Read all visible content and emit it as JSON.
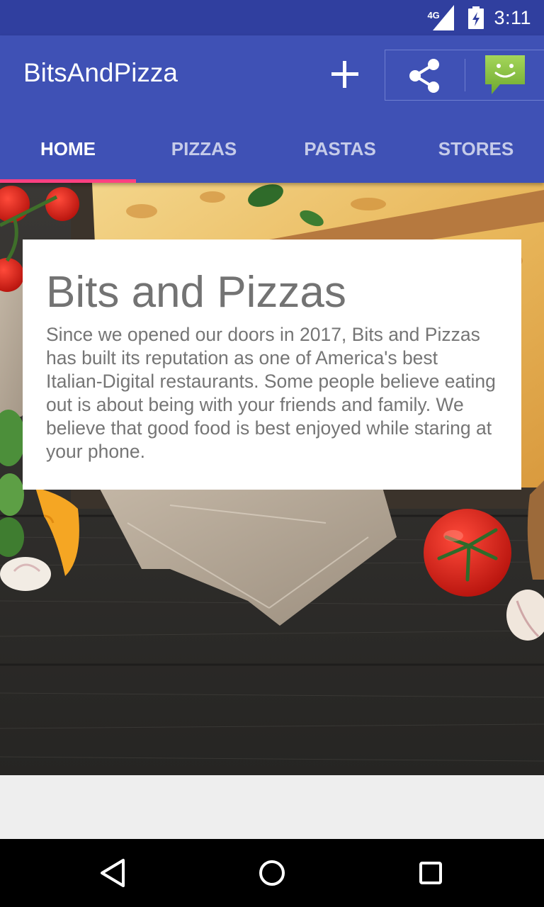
{
  "status_bar": {
    "network": "4G",
    "time": "3:11"
  },
  "app_bar": {
    "title": "BitsAndPizza",
    "actions": [
      "add-icon",
      "share-icon",
      "message-icon"
    ]
  },
  "tabs": [
    {
      "label": "HOME",
      "active": true
    },
    {
      "label": "PIZZAS",
      "active": false
    },
    {
      "label": "PASTAS",
      "active": false
    },
    {
      "label": "STORES",
      "active": false
    }
  ],
  "card": {
    "title": "Bits and Pizzas",
    "body": "Since we opened our doors in 2017, Bits and Pizzas has built its reputation as one of America's best Italian-Digital restaurants. Some people believe eating out is about being with your friends and family. We believe that good food is best enjoyed while staring at your phone."
  },
  "nav_bar": {
    "buttons": [
      "back-icon",
      "home-icon",
      "recents-icon"
    ]
  },
  "colors": {
    "primary": "#3f51b5",
    "primary_dark": "#303f9f",
    "accent": "#ff4081",
    "message_icon": "#8bc34a"
  }
}
